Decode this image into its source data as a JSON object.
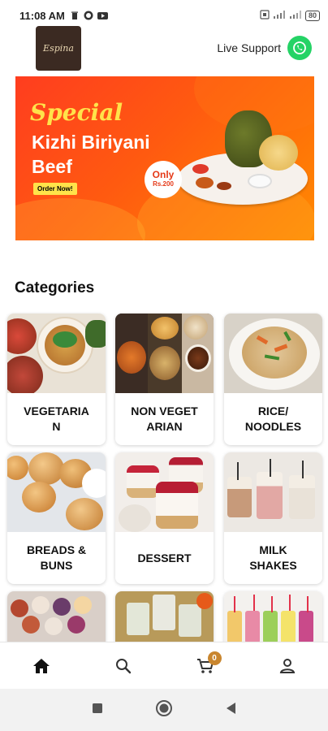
{
  "status_bar": {
    "time": "11:08 AM",
    "battery": "80",
    "icons": [
      "delete-icon",
      "whatsapp-icon",
      "youtube-icon",
      "sim-icon",
      "signal-icon",
      "signal-icon-2"
    ]
  },
  "header": {
    "logo_text": "Espina",
    "live_support_label": "Live Support",
    "whatsapp_color": "#25d366"
  },
  "banner": {
    "special": "Special",
    "title_line1": "Kizhi Biriyani",
    "title_line2": "Beef",
    "cta": "Order Now!",
    "price_line1": "Only",
    "price_line2": "Rs.200"
  },
  "categories": {
    "title": "Categories",
    "items": [
      {
        "label": "VEGETARIA\nN",
        "image": "vegetarian-dishes"
      },
      {
        "label": "NON VEGET\nARIAN",
        "image": "non-veg-dishes"
      },
      {
        "label": "RICE/\nNOODLES",
        "image": "noodles-plate"
      },
      {
        "label": "BREADS &\nBUNS",
        "image": "bread-buns"
      },
      {
        "label": "DESSERT",
        "image": "dessert-cups"
      },
      {
        "label": "MILK\nSHAKES",
        "image": "milkshakes"
      },
      {
        "label": "",
        "image": "pastries"
      },
      {
        "label": "",
        "image": "drinks-glasses"
      },
      {
        "label": "",
        "image": "fruit-juices"
      }
    ]
  },
  "bottom_nav": {
    "items": [
      "home-icon",
      "search-icon",
      "cart-icon",
      "profile-icon"
    ],
    "cart_count": "0",
    "badge_color": "#c9862f"
  },
  "system_nav": {
    "items": [
      "recents-button",
      "home-button",
      "back-button"
    ]
  }
}
